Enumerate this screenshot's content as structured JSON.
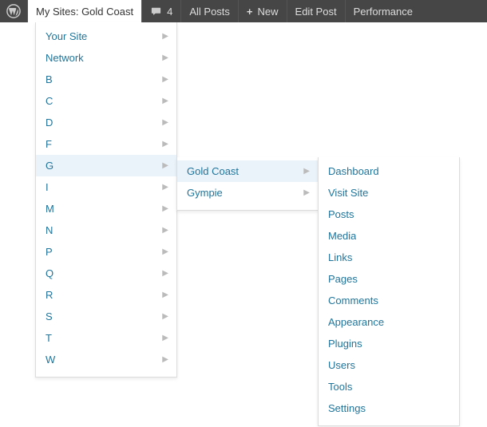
{
  "adminbar": {
    "my_sites_label": "My Sites: Gold Coast",
    "comments_count": "4",
    "all_posts": "All Posts",
    "new": "New",
    "edit_post": "Edit Post",
    "performance": "Performance"
  },
  "level1": [
    {
      "label": "Your Site",
      "has_sub": true,
      "hover": false
    },
    {
      "label": "Network",
      "has_sub": true,
      "hover": false
    },
    {
      "label": "B",
      "has_sub": true,
      "hover": false
    },
    {
      "label": "C",
      "has_sub": true,
      "hover": false
    },
    {
      "label": "D",
      "has_sub": true,
      "hover": false
    },
    {
      "label": "F",
      "has_sub": true,
      "hover": false
    },
    {
      "label": "G",
      "has_sub": true,
      "hover": true
    },
    {
      "label": "I",
      "has_sub": true,
      "hover": false
    },
    {
      "label": "M",
      "has_sub": true,
      "hover": false
    },
    {
      "label": "N",
      "has_sub": true,
      "hover": false
    },
    {
      "label": "P",
      "has_sub": true,
      "hover": false
    },
    {
      "label": "Q",
      "has_sub": true,
      "hover": false
    },
    {
      "label": "R",
      "has_sub": true,
      "hover": false
    },
    {
      "label": "S",
      "has_sub": true,
      "hover": false
    },
    {
      "label": "T",
      "has_sub": true,
      "hover": false
    },
    {
      "label": "W",
      "has_sub": true,
      "hover": false
    }
  ],
  "level2": [
    {
      "label": "Gold Coast",
      "has_sub": true,
      "hover": true
    },
    {
      "label": "Gympie",
      "has_sub": true,
      "hover": false
    }
  ],
  "level3": [
    {
      "label": "Dashboard"
    },
    {
      "label": "Visit Site"
    },
    {
      "label": "Posts"
    },
    {
      "label": "Media"
    },
    {
      "label": "Links"
    },
    {
      "label": "Pages"
    },
    {
      "label": "Comments"
    },
    {
      "label": "Appearance"
    },
    {
      "label": "Plugins"
    },
    {
      "label": "Users"
    },
    {
      "label": "Tools"
    },
    {
      "label": "Settings"
    }
  ]
}
